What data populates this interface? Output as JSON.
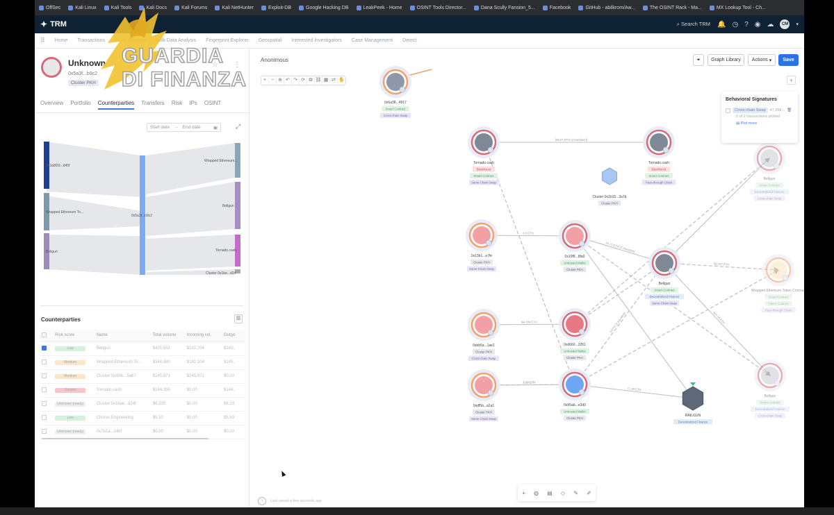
{
  "bookmarks": [
    "OffSec",
    "Kali Linux",
    "Kali Tools",
    "Kali Docs",
    "Kali Forums",
    "Kali NetHunter",
    "Exploit-DB",
    "Google Hacking DB",
    "LeakPeek - Home",
    "OSINT Tools Director...",
    "Dana Scully Fansion_5...",
    "Facebook",
    "GitHub - abilkrom/Aw...",
    "The OSINT Rack - Ma...",
    "MX Lookup Tool - Ch..."
  ],
  "header": {
    "logo": "TRM",
    "search": "Search TRM",
    "avatar": "CM"
  },
  "nav": [
    "Home",
    "Transactions",
    "Block Explorer",
    "Bulk Data Analysis",
    "Fingerprint Explorer",
    "Geospatial",
    "Interested Investigators",
    "Case Management",
    "Detect"
  ],
  "watermark": {
    "line1": "GUARDIA",
    "line2": "DI FINANZA"
  },
  "entity": {
    "name": "Unknown",
    "address": "0x5a3f...b9c2",
    "badge": "Cluster PKH"
  },
  "tabs": [
    "Overview",
    "Portfolio",
    "Counterparties",
    "Transfers",
    "Risk",
    "IPs",
    "OSINT"
  ],
  "date": {
    "start": "Start date",
    "end": "End date"
  },
  "sankey": {
    "left": [
      "0x3a8f2d...d45f",
      "Wrapped Ethereum To...",
      "Bellgun"
    ],
    "center": "0x5a3f...b9c2",
    "right": [
      "Wrapped Ethereum...",
      "Bellgun",
      "Tornado.cash",
      "Cluster 0x1be...d24"
    ]
  },
  "counterparties": {
    "title": "Counterparties",
    "columns": [
      "",
      "Risk score",
      "Name",
      "Total volume",
      "Incoming vol.",
      "Outgo"
    ],
    "rows": [
      {
        "risk": "Low",
        "name": "Bellgun",
        "total": "$425,651",
        "incoming": "$182,704",
        "out": "$243,",
        "checked": true,
        "color": "#d5f0dc"
      },
      {
        "risk": "Medium",
        "name": "Wrapped Ethereum To...",
        "total": "$344,980",
        "incoming": "$182,104",
        "out": "$245,",
        "checked": false,
        "color": "#fbe6cc"
      },
      {
        "risk": "Medium",
        "name": "Cluster 0xd9fe...5ab7",
        "total": "$245,971",
        "incoming": "$245,971",
        "out": "$0.00",
        "checked": false,
        "color": "#fbe6cc"
      },
      {
        "risk": "Severe",
        "name": "Tornado.cash",
        "total": "$144,356",
        "incoming": "$0.00",
        "out": "$144,",
        "checked": false,
        "color": "#f7c4cc"
      },
      {
        "risk": "Unknown (ready)",
        "name": "Cluster 0x1bae...d24f",
        "total": "$6,335",
        "incoming": "$0.00",
        "out": "$6,33",
        "checked": false,
        "color": "#eceef1"
      },
      {
        "risk": "Low",
        "name": "Chorus Engineering",
        "total": "$5.50",
        "incoming": "$0.00",
        "out": "$5.50",
        "checked": false,
        "color": "#d5f0dc"
      },
      {
        "risk": "Unknown (ready)",
        "name": "0x7b1a...24bf",
        "total": "$0.00",
        "incoming": "$0.00",
        "out": "$0.00",
        "checked": false,
        "color": "#eceef1"
      }
    ]
  },
  "canvas": {
    "title": "Anonimous",
    "graph_library": "Graph Library",
    "actions": "Actions",
    "save": "Save",
    "feedback": "Last saved a few seconds ago"
  },
  "behavioral": {
    "title": "Behavioral Signatures",
    "pill": "Cross-chain Swap",
    "count": "47,398...",
    "sub": "0 of 2 transactions plotted",
    "more": "Plot more"
  },
  "nodes": [
    {
      "id": "n0",
      "label": "0x6a38...4917",
      "tags": [
        "Smart Contract",
        "Cross-chain Swap"
      ],
      "ring": "#f4a06a",
      "fill": "#8e98a8"
    },
    {
      "id": "n1",
      "label": "Tornado.cash",
      "tags": [
        "Blacklisted",
        "Smart Contract",
        "Same-Chain Swap"
      ],
      "ring": "#d66a7a",
      "fill": "#7e8896"
    },
    {
      "id": "n2",
      "label": "Tornado.cash",
      "tags": [
        "Blacklisted",
        "Smart Contract",
        "Pass-through Chain"
      ],
      "ring": "#d66a7a",
      "fill": "#7e8896"
    },
    {
      "id": "n3",
      "label": "Cluster 0x1b15...3a7b",
      "tags": [
        "Cluster PKH"
      ],
      "ring": "none",
      "fill": "#a8c7f2"
    },
    {
      "id": "n4",
      "label": "0x13b1...e7fe",
      "tags": [
        "Cluster PKH",
        "Same-Chain Swap"
      ],
      "ring": "#f4a06a",
      "fill": "#f2a0a6"
    },
    {
      "id": "n5",
      "label": "0x10f8...8fa0",
      "tags": [
        "Unhosted Wallet",
        "Cluster PKH"
      ],
      "ring": "#d66a7a",
      "fill": "#f2a0a6"
    },
    {
      "id": "n6",
      "label": "Bellgun",
      "tags": [
        "Smart Contract",
        "Decentralized Finance",
        "Same-Chain Swap"
      ],
      "ring": "#d66a7a",
      "fill": "#7e8896"
    },
    {
      "id": "n7",
      "label": "Bellgun",
      "tags": [
        "Smart Contract",
        "Decentralized Finance",
        "Cross-chain Swap"
      ],
      "ring": "#d66a7a",
      "fill": "#c9ccd2"
    },
    {
      "id": "n8",
      "label": "Wrapped Ethereum Token Contract",
      "tags": [
        "Smart Contract",
        "Token Contract",
        "Pass-through Chain"
      ],
      "ring": "#f4a06a",
      "fill": "#fde3c4"
    },
    {
      "id": "n9",
      "label": "0xbb5a...1ae1",
      "tags": [
        "Cluster PKH",
        "Cross-chain Swap"
      ],
      "ring": "#f4a06a",
      "fill": "#f2a0a6"
    },
    {
      "id": "n10",
      "label": "0xd660...2261",
      "tags": [
        "Unhosted Wallet",
        "Cluster PKH"
      ],
      "ring": "#d66a7a",
      "fill": "#e87884"
    },
    {
      "id": "n11",
      "label": "0xdf5b...a2a1",
      "tags": [
        "Cluster PKH",
        "Same-Chain Swap"
      ],
      "ring": "#f4a06a",
      "fill": "#f2a0a6"
    },
    {
      "id": "n12",
      "label": "0x95ab...e3d0",
      "tags": [
        "Unhosted Wallet",
        "Cluster PKH"
      ],
      "ring": "#d66a7a",
      "fill": "#6fa6f4"
    },
    {
      "id": "n13",
      "label": "Bellgun",
      "tags": [
        "Smart Contract",
        "Decentralized Finance",
        "Cross-chain Swap"
      ],
      "ring": "#d66a7a",
      "fill": "#c9ccd2"
    },
    {
      "id": "n14",
      "label": "RAILGUN",
      "tags": [
        "Decentralized Finance"
      ],
      "ring": "none",
      "fill": "#5d6878"
    }
  ],
  "edges": [
    {
      "label": "(98.07 ETH (2 transfers))"
    },
    {
      "label": "4.0 ETH"
    },
    {
      "label": "24.71 ETH (2 transfers)"
    },
    {
      "label": "$4,786 ETH"
    },
    {
      "label": "7.77 ETH"
    },
    {
      "label": "5.58 ETH"
    },
    {
      "label": "8 ETH (2 transfers)"
    },
    {
      "label": "71.99 ETH"
    },
    {
      "label": "$3,107 ETH"
    },
    {
      "label": "$10.74 ETH"
    }
  ],
  "colors": {
    "accent": "#2b72e6",
    "topbar": "#0f2233",
    "bookmarks": "#2b2d31",
    "watermark": "#f2c230"
  }
}
